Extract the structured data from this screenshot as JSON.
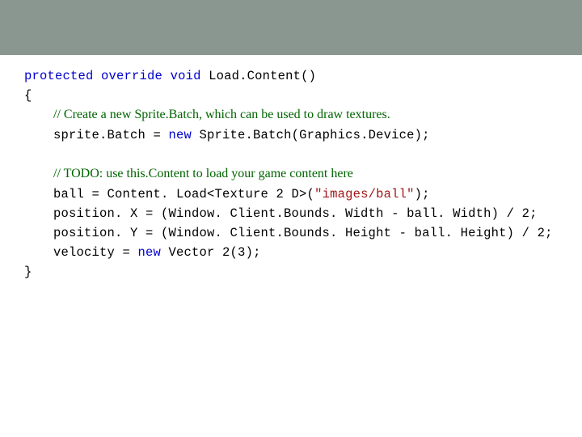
{
  "code": {
    "l1_kw1": "protected",
    "l1_sp1": " ",
    "l1_kw2": "override",
    "l1_sp2": " ",
    "l1_kw3": "void",
    "l1_rest": " Load.Content()",
    "l2": "{",
    "l3_cmt": "// Create a new Sprite.Batch, which can be used to draw textures.",
    "l4_a": "sprite.Batch = ",
    "l4_kw": "new",
    "l4_b": " Sprite.Batch(Graphics.Device);",
    "blank1": " ",
    "l6_cmt": "// TODO: use this.Content to load your game content here",
    "l7_a": "ball = Content. Load<Texture 2 D>(",
    "l7_str": "\"images/ball\"",
    "l7_b": ");",
    "l8": "position. X = (Window. Client.Bounds. Width - ball. Width) / 2;",
    "l9": "position. Y = (Window. Client.Bounds. Height - ball. Height) / 2;",
    "l10_a": "velocity = ",
    "l10_kw": "new",
    "l10_b": " Vector 2(3);",
    "l11": "}"
  }
}
